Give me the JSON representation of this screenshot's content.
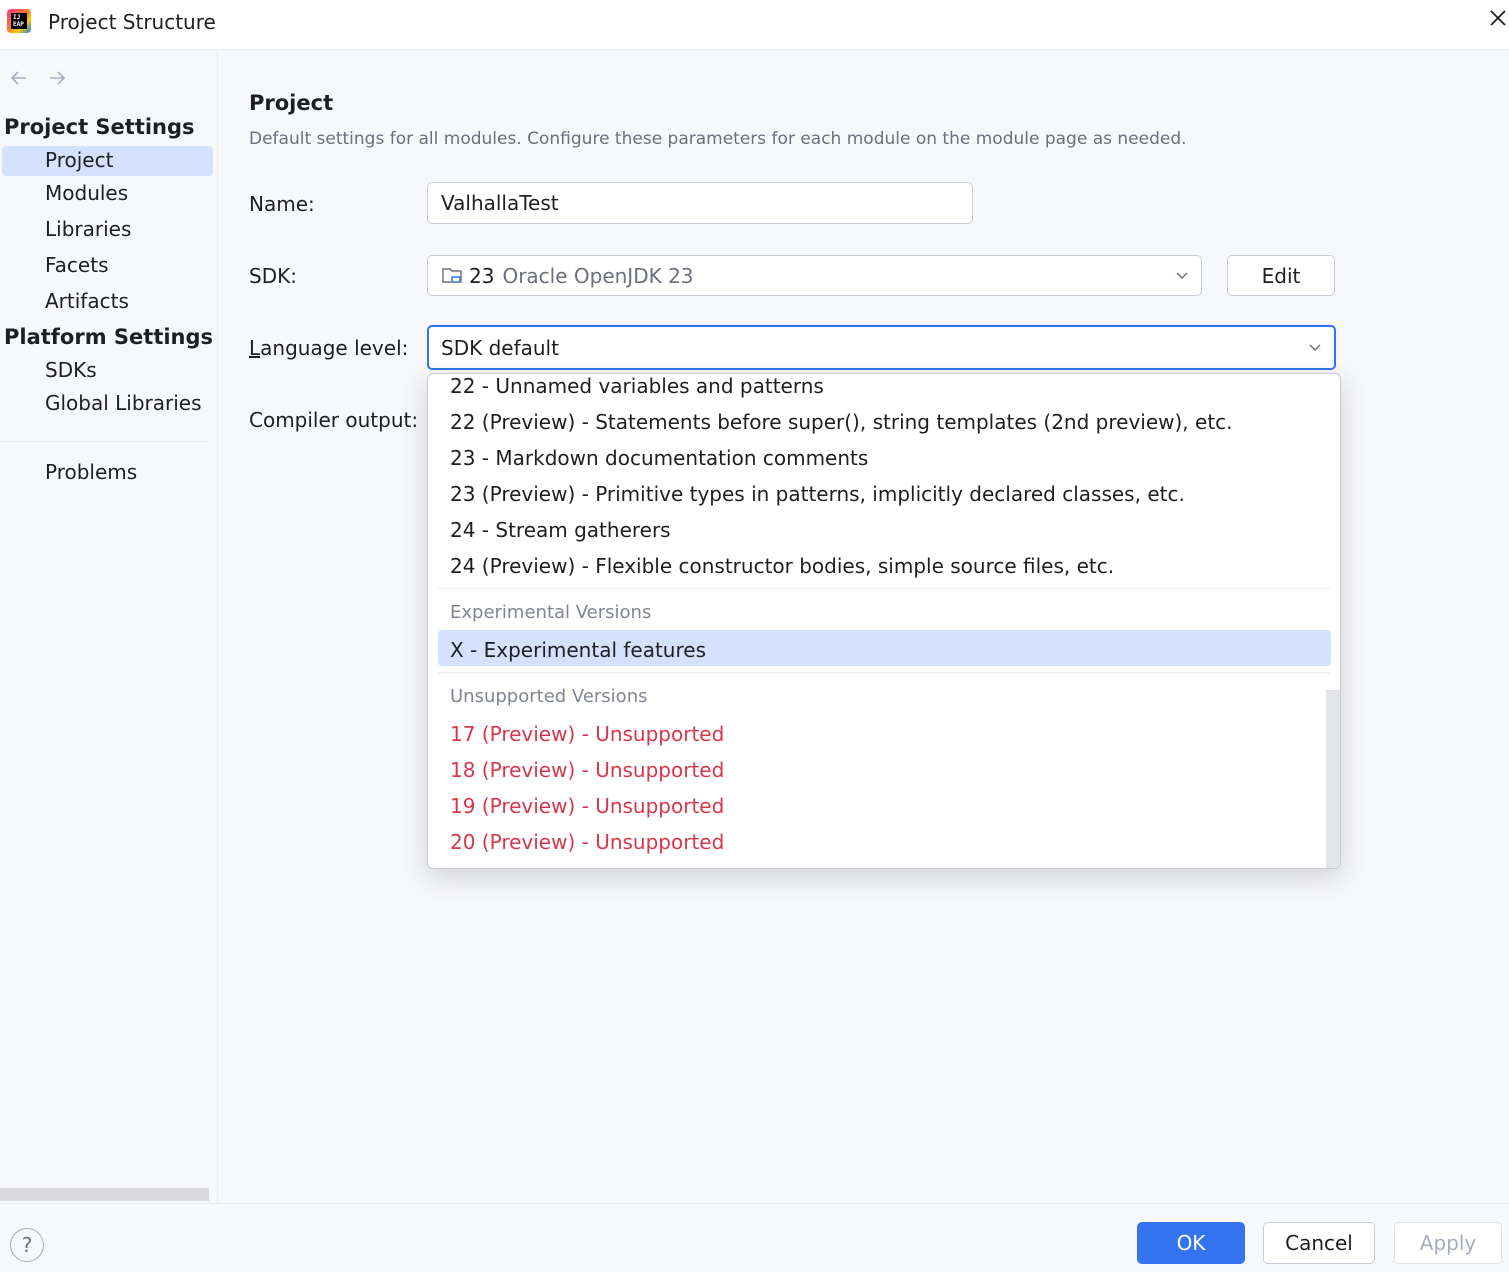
{
  "window": {
    "title": "Project Structure",
    "app_icon_text": "IJ EAP"
  },
  "sidebar": {
    "project_settings_header": "Project Settings",
    "project_items": [
      "Project",
      "Modules",
      "Libraries",
      "Facets",
      "Artifacts"
    ],
    "platform_settings_header": "Platform Settings",
    "platform_items": [
      "SDKs",
      "Global Libraries"
    ],
    "problems_label": "Problems",
    "selected_item": "Project"
  },
  "main": {
    "title": "Project",
    "description": "Default settings for all modules. Configure these parameters for each module on the module page as needed.",
    "name_label": "Name:",
    "name_value": "ValhallaTest",
    "sdk_label": "SDK:",
    "sdk_version": "23",
    "sdk_name": "Oracle OpenJDK 23",
    "edit_label": "Edit",
    "language_level_mnemonic": "L",
    "language_level_label_rest": "anguage level:",
    "language_level_value": "SDK default",
    "compiler_output_label": "Compiler output:"
  },
  "dropdown": {
    "options": [
      "22 - Unnamed variables and patterns",
      "22 (Preview) - Statements before super(), string templates (2nd preview), etc.",
      "23 - Markdown documentation comments",
      "23 (Preview) - Primitive types in patterns, implicitly declared classes, etc.",
      "24 - Stream gatherers",
      "24 (Preview) - Flexible constructor bodies, simple source files, etc."
    ],
    "experimental_header": "Experimental Versions",
    "experimental_option": "X - Experimental features",
    "unsupported_header": "Unsupported Versions",
    "unsupported_options": [
      "17 (Preview) - Unsupported",
      "18 (Preview) - Unsupported",
      "19 (Preview) - Unsupported",
      "20 (Preview) - Unsupported"
    ],
    "selected_option": "X - Experimental features"
  },
  "footer": {
    "help_label": "?",
    "ok_label": "OK",
    "cancel_label": "Cancel",
    "apply_label": "Apply"
  },
  "colors": {
    "accent": "#3574f0",
    "selection": "#d5e1fd",
    "unsupported_text": "#d9364a",
    "muted_text": "#6c707e"
  }
}
